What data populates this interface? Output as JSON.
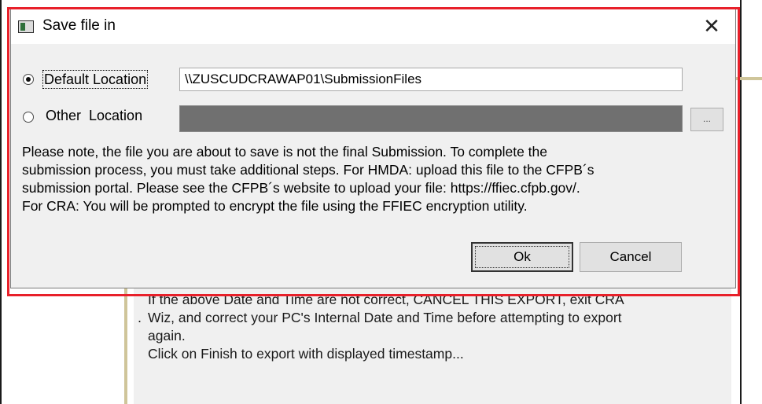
{
  "dialog": {
    "title": "Save file in",
    "close_glyph": "✕",
    "default_location": {
      "label": "Default Location",
      "value": "\\\\ZUSCUDCRAWAP01\\SubmissionFiles",
      "selected": true
    },
    "other_location": {
      "label": "Other  Location",
      "value": "",
      "selected": false
    },
    "browse_label": "...",
    "note_lines": [
      "Please note, the file you are about to save is not the final Submission. To complete the",
      "submission process, you must take additional steps. For HMDA: upload this file to the CFPB´s",
      "submission portal. Please see the CFPB´s website to upload your file: https://ffiec.cfpb.gov/.",
      "For CRA: You will be prompted to encrypt the file using the FFIEC encryption utility."
    ],
    "ok_label": "Ok",
    "cancel_label": "Cancel"
  },
  "background_window": {
    "lines": [
      "If the above Date and Time are not correct, CANCEL THIS EXPORT, exit CRA",
      "Wiz, and correct your PC's Internal Date and Time before attempting to export",
      "again.",
      "Click on Finish to export with displayed timestamp..."
    ],
    "bullet": "."
  },
  "colors": {
    "highlight": "#e8202a",
    "dialog_bg": "#f0f0f0",
    "disabled_field": "#707070"
  },
  "icons": [
    "app-window-icon",
    "close-icon",
    "radio-checked-icon",
    "radio-unchecked-icon"
  ]
}
